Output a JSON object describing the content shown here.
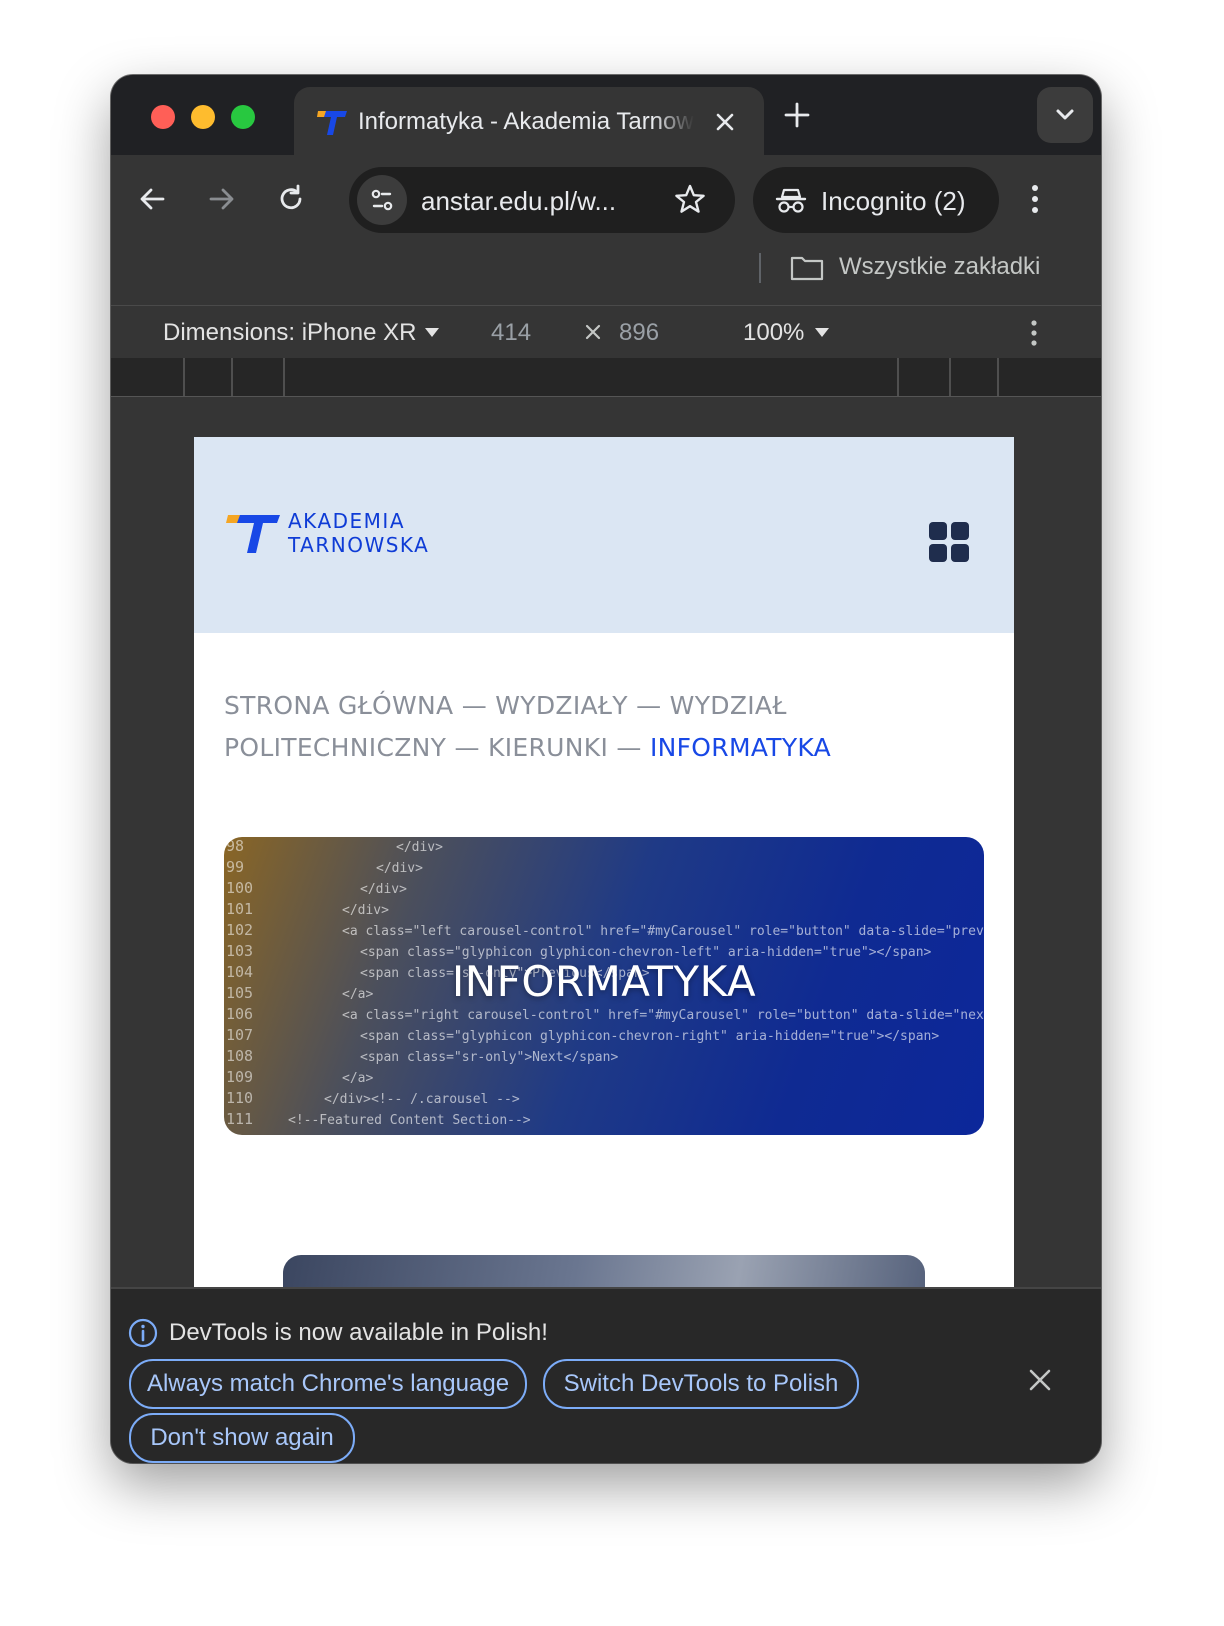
{
  "colors": {
    "accent_blue": "#1848e6",
    "logo_orange": "#f5a623",
    "header_bg": "#dbe6f3",
    "link_blue": "#a8c7fa"
  },
  "tab": {
    "title": "Informatyka - Akademia Tarnowska",
    "close_icon": "close-icon",
    "new_tab_icon": "plus-icon",
    "tab_search_icon": "chevron-down-icon"
  },
  "toolbar": {
    "url": "anstar.edu.pl/w...",
    "incognito_label": "Incognito (2)",
    "icons": [
      "back-arrow-icon",
      "forward-arrow-icon",
      "reload-icon",
      "site-info-icon",
      "star-icon",
      "incognito-icon",
      "kebab-menu-icon"
    ]
  },
  "bookmarks": {
    "all_bookmarks_label": "Wszystkie zakładki"
  },
  "device_toolbar": {
    "dimensions_label": "Dimensions: iPhone XR",
    "width": "414",
    "times": "×",
    "height": "896",
    "zoom": "100%"
  },
  "site": {
    "logo_line1": "AKADEMIA",
    "logo_line2": "TARNOWSKA",
    "breadcrumb": {
      "home": "STRONA GŁÓWNA",
      "faculties": "WYDZIAŁY",
      "faculty": "WYDZIAŁ POLITECHNICZNY",
      "programs": "KIERUNKI",
      "current": "INFORMATYKA",
      "separator": "—"
    },
    "hero_title": "INFORMATYKA",
    "hero_code_lines": [
      {
        "n": "98",
        "code": "</div>"
      },
      {
        "n": "99",
        "code": "</div>"
      },
      {
        "n": "100",
        "code": "</div>"
      },
      {
        "n": "101",
        "code": "</div>"
      },
      {
        "n": "102",
        "code": "<a class=\"left carousel-control\" href=\"#myCarousel\" role=\"button\" data-slide=\"prev\">"
      },
      {
        "n": "103",
        "code": "<span class=\"glyphicon glyphicon-chevron-left\" aria-hidden=\"true\"></span>"
      },
      {
        "n": "104",
        "code": "<span class=\"sr-only\">Previous</span>"
      },
      {
        "n": "105",
        "code": "</a>"
      },
      {
        "n": "106",
        "code": "<a class=\"right carousel-control\" href=\"#myCarousel\" role=\"button\" data-slide=\"next\">"
      },
      {
        "n": "107",
        "code": "<span class=\"glyphicon glyphicon-chevron-right\" aria-hidden=\"true\"></span>"
      },
      {
        "n": "108",
        "code": "<span class=\"sr-only\">Next</span>"
      },
      {
        "n": "109",
        "code": "</a>"
      },
      {
        "n": "110",
        "code": "</div><!-- /.carousel -->"
      },
      {
        "n": "111",
        "code": "<!--Featured Content Section-->"
      }
    ]
  },
  "infobar": {
    "message": "DevTools is now available in Polish!",
    "btn_always_match": "Always match Chrome's language",
    "btn_switch": "Switch DevTools to Polish",
    "btn_dont_show": "Don't show again"
  }
}
